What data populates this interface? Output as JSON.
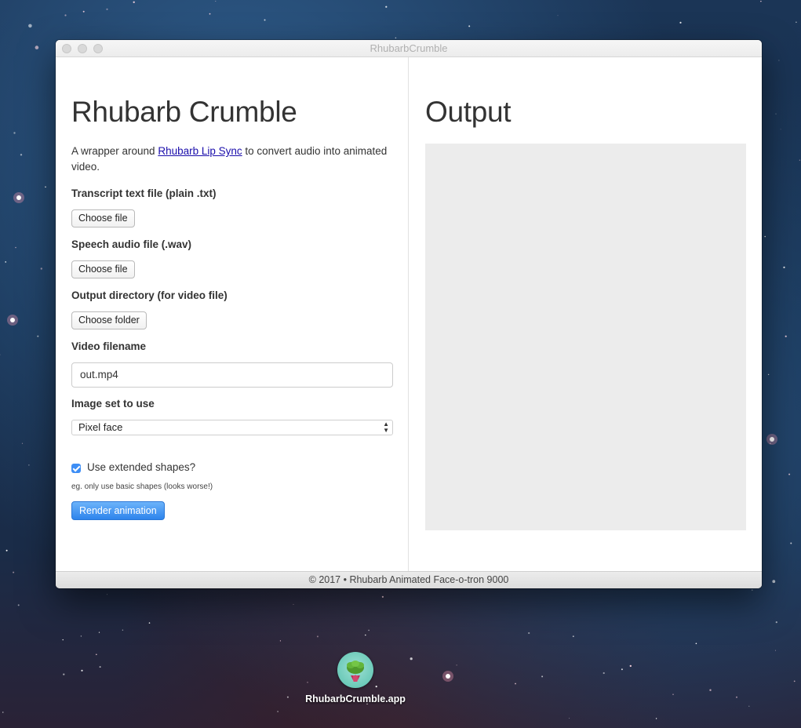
{
  "window": {
    "title": "RhubarbCrumble"
  },
  "left": {
    "heading": "Rhubarb Crumble",
    "intro_before": "A wrapper around ",
    "intro_link": "Rhubarb Lip Sync",
    "intro_after": " to convert audio into animated video.",
    "transcript_label": "Transcript text file (plain .txt)",
    "transcript_button": "Choose file",
    "audio_label": "Speech audio file (.wav)",
    "audio_button": "Choose file",
    "output_dir_label": "Output directory (for video file)",
    "output_dir_button": "Choose folder",
    "video_filename_label": "Video filename",
    "video_filename_value": "out.mp4",
    "image_set_label": "Image set to use",
    "image_set_selected": "Pixel face",
    "extended_label": "Use extended shapes?",
    "extended_checked": true,
    "extended_hint": "eg. only use basic shapes (looks worse!)",
    "render_button": "Render animation"
  },
  "right": {
    "heading": "Output"
  },
  "footer": {
    "text": "© 2017 • Rhubarb Animated Face-o-tron 9000"
  },
  "desktop": {
    "app_label": "RhubarbCrumble.app"
  },
  "colors": {
    "accent": "#3d8ef5",
    "output_bg": "#ececec",
    "link": "#1a0dab"
  }
}
